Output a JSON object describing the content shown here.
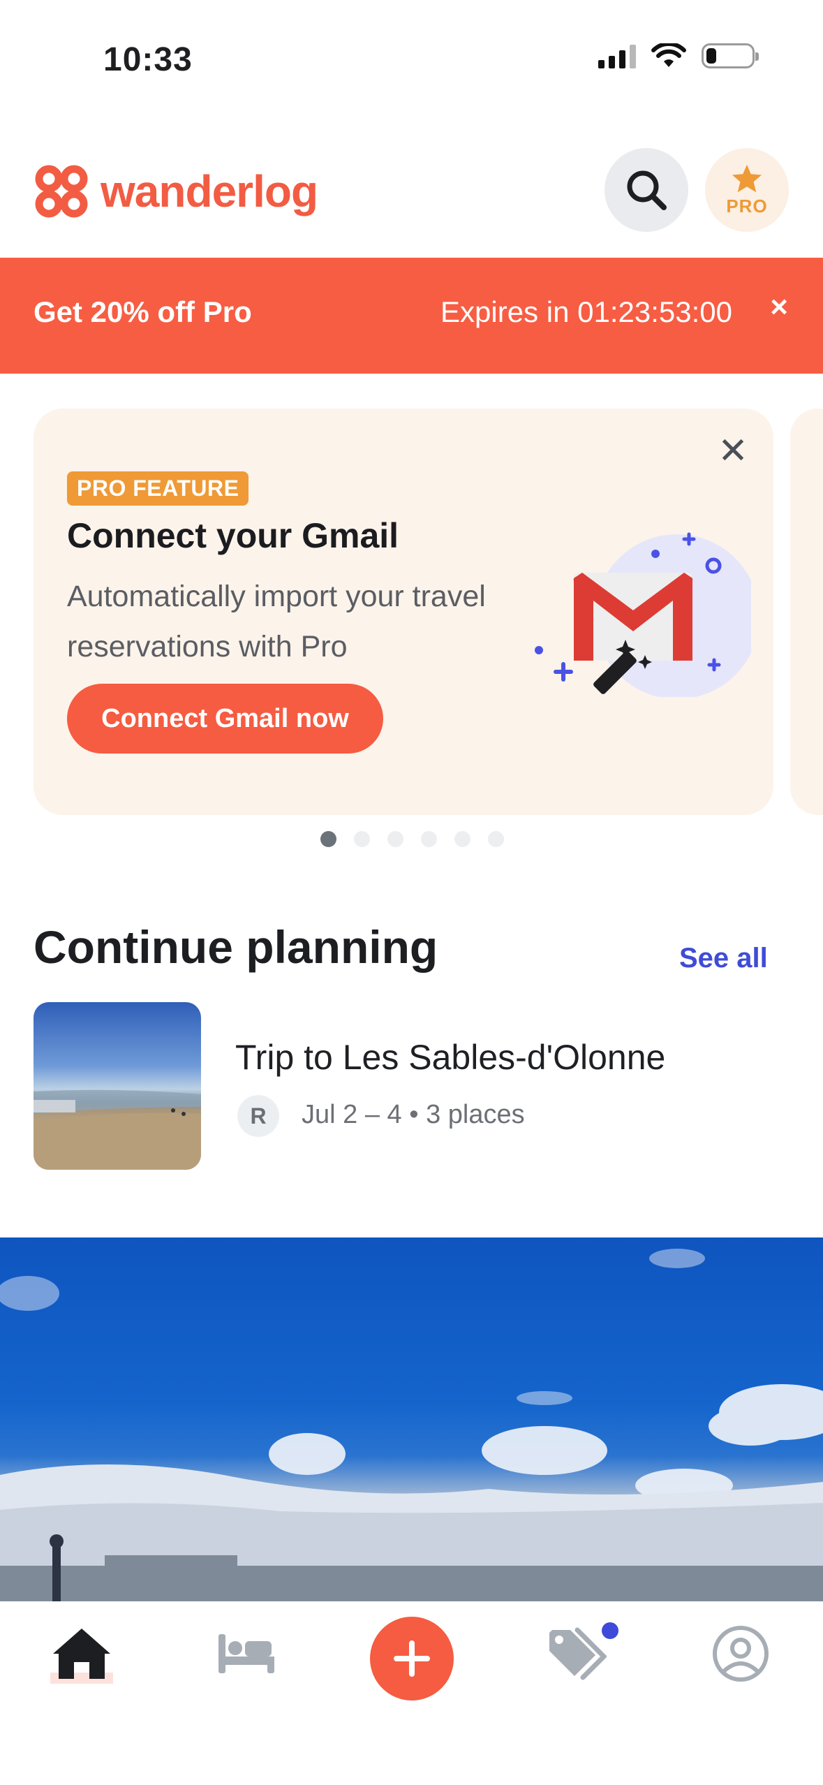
{
  "status_bar": {
    "time": "10:33"
  },
  "header": {
    "logo_text": "wanderlog",
    "pro_badge": "PRO"
  },
  "promo_banner": {
    "left_text": "Get 20% off Pro",
    "right_text": "Expires in 01:23:53:00",
    "close": "×"
  },
  "feature_card": {
    "badge": "PRO FEATURE",
    "title": "Connect your Gmail",
    "description": "Automatically import your travel reservations with Pro",
    "button_label": "Connect Gmail now",
    "close": "✕",
    "page_count": 6,
    "active_page": 1
  },
  "continue_planning": {
    "title": "Continue planning",
    "see_all": "See all",
    "trip": {
      "title": "Trip to Les Sables-d'Olonne",
      "avatar_initial": "R",
      "meta": "Jul 2 –  4 • 3 places"
    }
  },
  "tab_bar": {
    "tabs": [
      {
        "name": "home",
        "icon": "home-icon",
        "active": true
      },
      {
        "name": "hotels",
        "icon": "bed-icon",
        "active": false
      },
      {
        "name": "add",
        "icon": "plus-icon",
        "active": false
      },
      {
        "name": "deals",
        "icon": "tags-icon",
        "active": false,
        "notification": true
      },
      {
        "name": "profile",
        "icon": "user-circle-icon",
        "active": false
      }
    ]
  },
  "colors": {
    "brand": "#f55c41",
    "pro": "#ef9a36",
    "link": "#3f4cd6",
    "card_bg": "#fcf3ea"
  }
}
